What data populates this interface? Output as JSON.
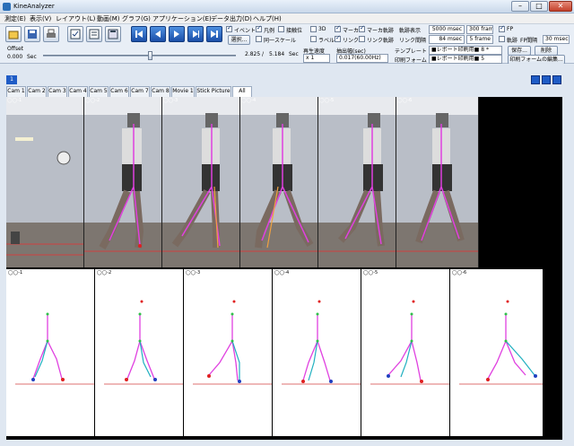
{
  "window": {
    "title": "KineAnalyzer"
  },
  "menu": [
    "測定(E)",
    "表示(V)",
    "レイアウト(L)",
    "動画(M)",
    "グラフ(G)",
    "アプリケーション(E)",
    "データ出力(D)",
    "ヘルプ(H)"
  ],
  "toolbar": {
    "offset_label": "Offset",
    "offset_value": "0.000",
    "offset_unit": "Sec",
    "time_current": "2.825",
    "time_separator": "/",
    "time_total": "5.184",
    "time_unit": "Sec",
    "playback_speed_label": "再生速度",
    "playback_speed_value": "x 1",
    "frame_interval_label": "抽出幅(sec)",
    "frame_interval_value": "0.017(60.00Hz)",
    "checks": [
      {
        "label": "イベント",
        "checked": true
      },
      {
        "label": "凡例",
        "checked": true
      },
      {
        "label": "接触位",
        "checked": false
      },
      {
        "label": "3D",
        "checked": false
      },
      {
        "label": "マーカ",
        "checked": true
      },
      {
        "label": "マーカ軌跡",
        "checked": true
      },
      {
        "label": "ラベル",
        "checked": false
      },
      {
        "label": "リンク",
        "checked": true
      },
      {
        "label": "リンク軌跡",
        "checked": false
      },
      {
        "label": "同一スケール",
        "checked": false
      },
      {
        "label": "FP",
        "checked": true
      },
      {
        "label": "軌跡",
        "checked": false
      }
    ],
    "select_button": "選択...",
    "traj_display_label": "軌跡表示",
    "traj_display_value": "5000 msec",
    "traj_display_frames": "300 frame",
    "link_interval_label": "リンク間隔",
    "link_interval_value": "84 msec",
    "link_interval_frames": "5 frame",
    "fp_interval_label": "FP間隔",
    "fp_interval_value": "30 msec",
    "template_label": "テンプレート",
    "template_value": "■レポート印刷用■ 8 *",
    "print_form_label": "印刷フォーム",
    "print_form_value": "■レポート印刷用■ 5",
    "save_button": "保存...",
    "delete_button": "削除",
    "print_form_edit_button": "印刷フォームの編集..."
  },
  "view": {
    "index_badge": "1",
    "tabs": [
      "Cam 1",
      "Cam 2",
      "Cam 3",
      "Cam 4",
      "Cam 5",
      "Cam 6",
      "Cam 7",
      "Cam 8",
      "Movie 1",
      "Stick Picture",
      "All"
    ],
    "active_tab": "All",
    "frame_labels": [
      "◯◯-1",
      "◯◯-2",
      "◯◯-3",
      "◯◯-4",
      "◯◯-5",
      "◯◯-6"
    ],
    "stick_labels": [
      "◯◯-1",
      "◯◯-2",
      "◯◯-3",
      "◯◯-4",
      "◯◯-5",
      "◯◯-6"
    ]
  },
  "colors": {
    "link_magenta": "#e040e0",
    "link_green": "#2ec04a",
    "link_cyan": "#20b0c0",
    "marker_red": "#e02020",
    "marker_blue": "#2040c0",
    "floor_line": "#d04040"
  }
}
